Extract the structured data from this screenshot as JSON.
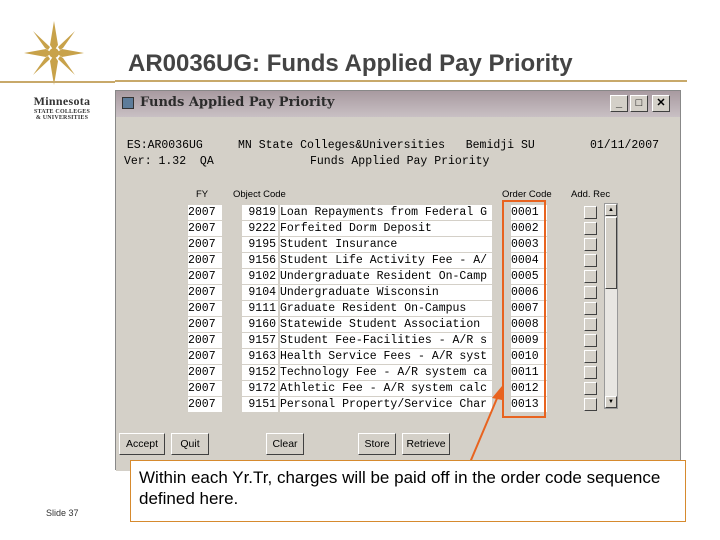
{
  "slide": {
    "title": "AR0036UG: Funds Applied Pay Priority",
    "logo_line1": "Minnesota",
    "logo_line2": "STATE COLLEGES",
    "logo_line3": "& UNIVERSITIES",
    "slide_number": "Slide 37",
    "callout": "Within each Yr.Tr, charges will be paid off in the order code sequence defined here."
  },
  "window": {
    "title": "Funds Applied Pay Priority",
    "min_icon": "minimize-icon",
    "max_icon": "maximize-icon",
    "close_icon": "close-icon",
    "header_left_1": " ES:AR0036UG",
    "header_left_2": "Ver: 1.32  QA",
    "header_center_1": "MN State Colleges&Universities   Bemidji SU",
    "header_center_2": "Funds Applied Pay Priority",
    "header_date": "01/11/2007"
  },
  "columns": {
    "fy": "FY",
    "object_code": "Object Code",
    "order_code": "Order Code",
    "add_rec": "Add. Rec"
  },
  "rows": [
    {
      "fy": "2007",
      "code": "9819",
      "desc": "Loan Repayments from Federal G",
      "order": "0001"
    },
    {
      "fy": "2007",
      "code": "9222",
      "desc": "Forfeited Dorm Deposit",
      "order": "0002"
    },
    {
      "fy": "2007",
      "code": "9195",
      "desc": "Student Insurance",
      "order": "0003"
    },
    {
      "fy": "2007",
      "code": "9156",
      "desc": "Student Life Activity Fee - A/",
      "order": "0004"
    },
    {
      "fy": "2007",
      "code": "9102",
      "desc": "Undergraduate Resident On-Camp",
      "order": "0005"
    },
    {
      "fy": "2007",
      "code": "9104",
      "desc": "Undergraduate Wisconsin",
      "order": "0006"
    },
    {
      "fy": "2007",
      "code": "9111",
      "desc": "Graduate Resident On-Campus",
      "order": "0007"
    },
    {
      "fy": "2007",
      "code": "9160",
      "desc": "Statewide Student Association",
      "order": "0008"
    },
    {
      "fy": "2007",
      "code": "9157",
      "desc": "Student Fee-Facilities - A/R s",
      "order": "0009"
    },
    {
      "fy": "2007",
      "code": "9163",
      "desc": "Health Service Fees - A/R syst",
      "order": "0010"
    },
    {
      "fy": "2007",
      "code": "9152",
      "desc": "Technology Fee - A/R system ca",
      "order": "0011"
    },
    {
      "fy": "2007",
      "code": "9172",
      "desc": "Athletic Fee - A/R system calc",
      "order": "0012"
    },
    {
      "fy": "2007",
      "code": "9151",
      "desc": "Personal Property/Service Char",
      "order": "0013"
    }
  ],
  "buttons": {
    "accept": "Accept",
    "quit": "Quit",
    "clear": "Clear",
    "store": "Store",
    "retrieve": "Retrieve"
  },
  "colors": {
    "highlight": "#e8631f",
    "gold": "#c8a96a"
  }
}
